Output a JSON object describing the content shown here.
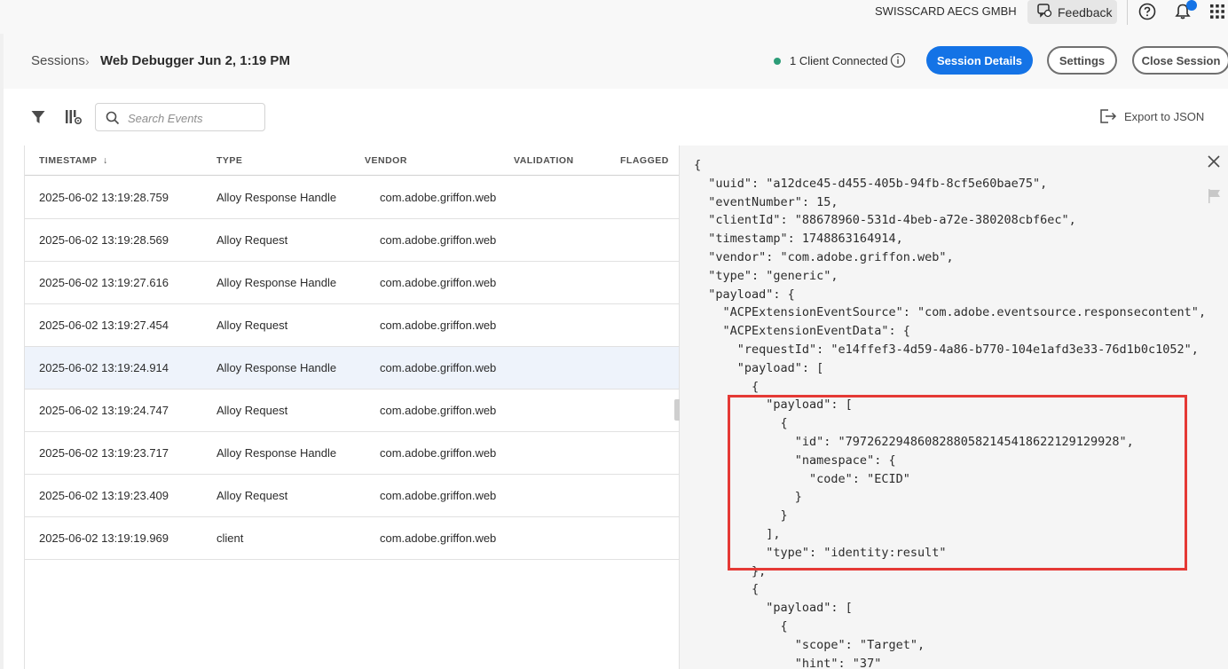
{
  "topbar": {
    "org_name": "SWISSCARD AECS GMBH",
    "feedback_label": "Feedback"
  },
  "breadcrumb": {
    "root": "Sessions",
    "separator": "›",
    "current": "Web Debugger Jun 2, 1:19 PM"
  },
  "connection": {
    "status_text": "1 Client Connected",
    "status_color": "#2d9d78"
  },
  "actions": {
    "session_details": "Session Details",
    "settings": "Settings",
    "close_session": "Close Session"
  },
  "toolbar": {
    "search_placeholder": "Search Events",
    "export_label": "Export to JSON"
  },
  "table": {
    "columns": [
      "TIMESTAMP",
      "TYPE",
      "VENDOR",
      "VALIDATION",
      "FLAGGED"
    ],
    "sort_indicator": "↓",
    "rows": [
      {
        "timestamp": "2025-06-02 13:19:28.759",
        "type": "Alloy Response Handle",
        "vendor": "com.adobe.griffon.web",
        "selected": false
      },
      {
        "timestamp": "2025-06-02 13:19:28.569",
        "type": "Alloy Request",
        "vendor": "com.adobe.griffon.web",
        "selected": false
      },
      {
        "timestamp": "2025-06-02 13:19:27.616",
        "type": "Alloy Response Handle",
        "vendor": "com.adobe.griffon.web",
        "selected": false
      },
      {
        "timestamp": "2025-06-02 13:19:27.454",
        "type": "Alloy Request",
        "vendor": "com.adobe.griffon.web",
        "selected": false
      },
      {
        "timestamp": "2025-06-02 13:19:24.914",
        "type": "Alloy Response Handle",
        "vendor": "com.adobe.griffon.web",
        "selected": true
      },
      {
        "timestamp": "2025-06-02 13:19:24.747",
        "type": "Alloy Request",
        "vendor": "com.adobe.griffon.web",
        "selected": false
      },
      {
        "timestamp": "2025-06-02 13:19:23.717",
        "type": "Alloy Response Handle",
        "vendor": "com.adobe.griffon.web",
        "selected": false
      },
      {
        "timestamp": "2025-06-02 13:19:23.409",
        "type": "Alloy Request",
        "vendor": "com.adobe.griffon.web",
        "selected": false
      },
      {
        "timestamp": "2025-06-02 13:19:19.969",
        "type": "client",
        "vendor": "com.adobe.griffon.web",
        "selected": false
      }
    ]
  },
  "detail": {
    "json_lines": [
      "{",
      "  \"uuid\": \"a12dce45-d455-405b-94fb-8cf5e60bae75\",",
      "  \"eventNumber\": 15,",
      "  \"clientId\": \"88678960-531d-4beb-a72e-380208cbf6ec\",",
      "  \"timestamp\": 1748863164914,",
      "  \"vendor\": \"com.adobe.griffon.web\",",
      "  \"type\": \"generic\",",
      "  \"payload\": {",
      "    \"ACPExtensionEventSource\": \"com.adobe.eventsource.responsecontent\",",
      "    \"ACPExtensionEventData\": {",
      "      \"requestId\": \"e14ffef3-4d59-4a86-b770-104e1afd3e33-76d1b0c1052\",",
      "      \"payload\": [",
      "        {",
      "          \"payload\": [",
      "            {",
      "              \"id\": \"79726229486082880582145418622129129928\",",
      "              \"namespace\": {",
      "                \"code\": \"ECID\"",
      "              }",
      "            }",
      "          ],",
      "          \"type\": \"identity:result\"",
      "        },",
      "        {",
      "          \"payload\": [",
      "            {",
      "              \"scope\": \"Target\",",
      "              \"hint\": \"37\""
    ]
  }
}
